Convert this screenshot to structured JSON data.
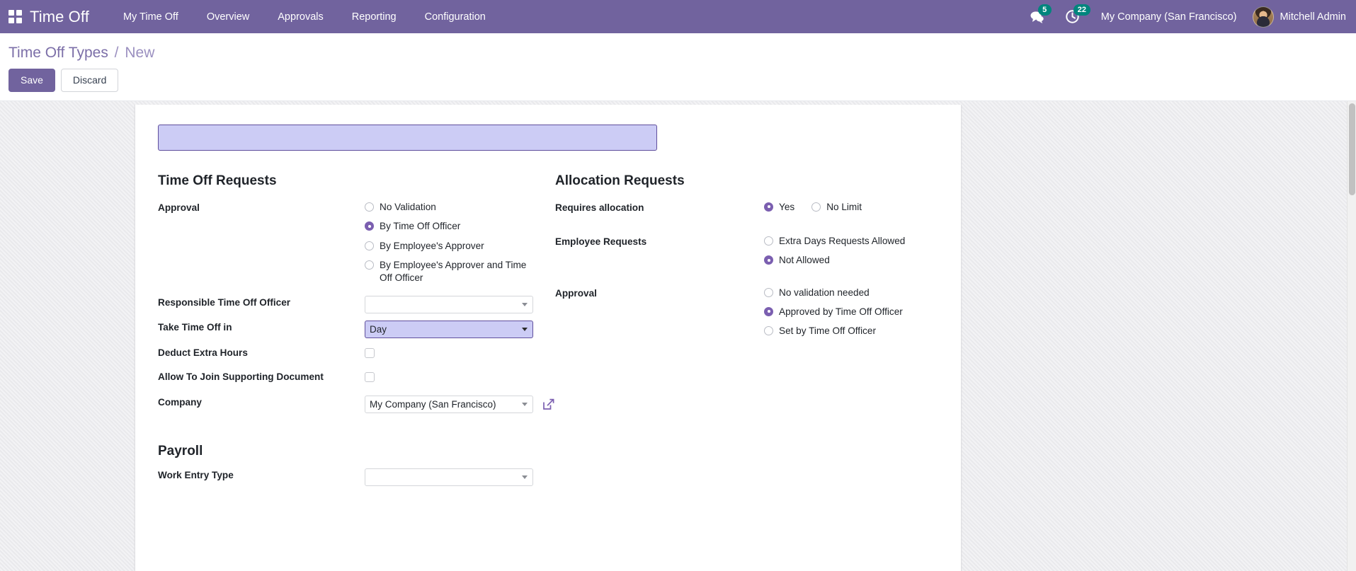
{
  "navbar": {
    "apps_icon": "apps-grid-icon",
    "brand": "Time Off",
    "menu": [
      {
        "label": "My Time Off"
      },
      {
        "label": "Overview"
      },
      {
        "label": "Approvals"
      },
      {
        "label": "Reporting"
      },
      {
        "label": "Configuration"
      }
    ],
    "messages_icon": "messages-icon",
    "messages_count": "5",
    "activities_icon": "activity-clock-icon",
    "activities_count": "22",
    "company": "My Company (San Francisco)",
    "user": "Mitchell Admin",
    "avatar_icon": "user-avatar",
    "brand_color": "#71639e",
    "badge_color": "#00857d"
  },
  "breadcrumb": {
    "parent": "Time Off Types",
    "separator": "/",
    "current": "New"
  },
  "actions": {
    "save_label": "Save",
    "discard_label": "Discard"
  },
  "form": {
    "name_value": "",
    "name_placeholder": "",
    "left": {
      "title": "Time Off Requests",
      "approval": {
        "label": "Approval",
        "options": [
          {
            "label": "No Validation",
            "checked": false
          },
          {
            "label": "By Time Off Officer",
            "checked": true
          },
          {
            "label": "By Employee's Approver",
            "checked": false
          },
          {
            "label": "By Employee's Approver and Time Off Officer",
            "checked": false
          }
        ]
      },
      "responsible_officer": {
        "label": "Responsible Time Off Officer",
        "value": ""
      },
      "take_time_off_in": {
        "label": "Take Time Off in",
        "value": "Day"
      },
      "deduct_extra_hours": {
        "label": "Deduct Extra Hours",
        "checked": false
      },
      "allow_supporting_document": {
        "label": "Allow To Join Supporting Document",
        "checked": false
      },
      "company": {
        "label": "Company",
        "value": "My Company (San Francisco)",
        "external_link_icon": "external-link-icon"
      }
    },
    "right": {
      "title": "Allocation Requests",
      "requires_allocation": {
        "label": "Requires allocation",
        "options": [
          {
            "label": "Yes",
            "checked": true
          },
          {
            "label": "No Limit",
            "checked": false
          }
        ]
      },
      "employee_requests": {
        "label": "Employee Requests",
        "options": [
          {
            "label": "Extra Days Requests Allowed",
            "checked": false
          },
          {
            "label": "Not Allowed",
            "checked": true
          }
        ]
      },
      "approval": {
        "label": "Approval",
        "options": [
          {
            "label": "No validation needed",
            "checked": false
          },
          {
            "label": "Approved by Time Off Officer",
            "checked": true
          },
          {
            "label": "Set by Time Off Officer",
            "checked": false
          }
        ]
      }
    },
    "payroll": {
      "title": "Payroll",
      "work_entry_type": {
        "label": "Work Entry Type",
        "value": ""
      }
    }
  }
}
